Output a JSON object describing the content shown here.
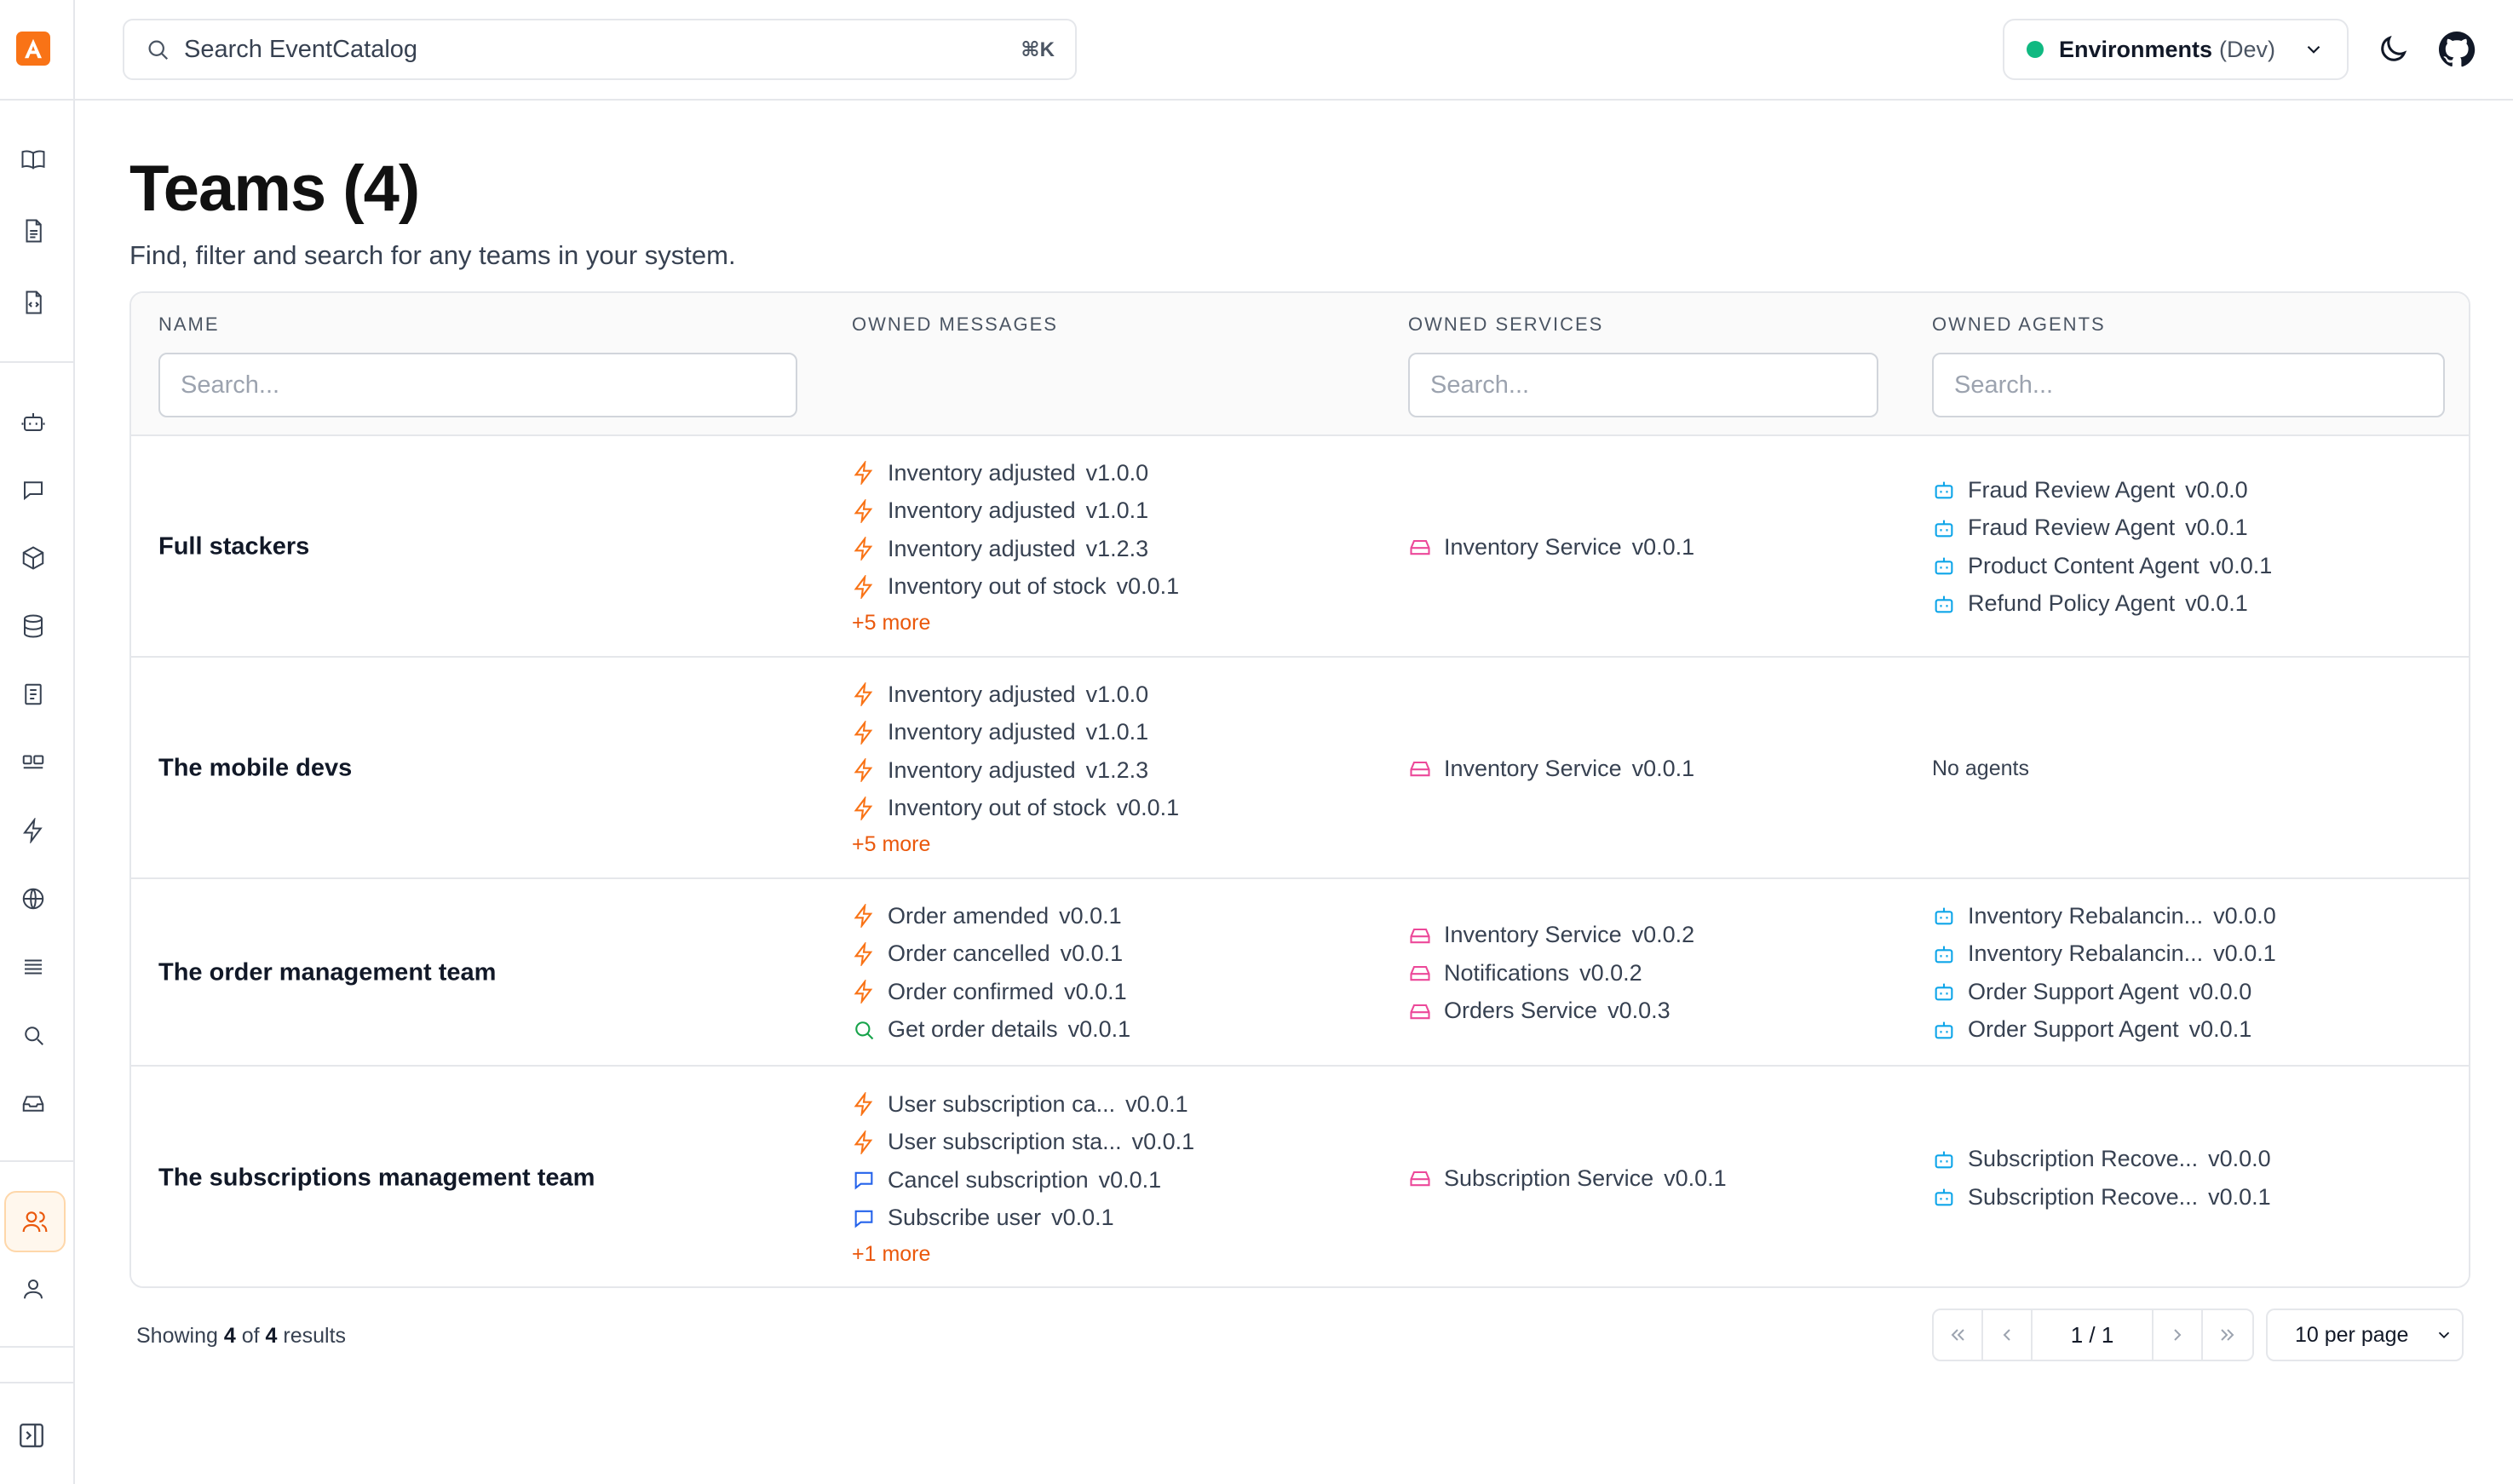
{
  "app": {
    "logo_letter": "A",
    "accent": "#f97316"
  },
  "search": {
    "placeholder": "Search EventCatalog",
    "shortcut": "⌘K"
  },
  "environment": {
    "label": "Environments",
    "value": "(Dev)",
    "status_color": "#10b981"
  },
  "page": {
    "title": "Teams (4)",
    "subtitle": "Find, filter and search for any teams in your system."
  },
  "table": {
    "headers": {
      "name": "NAME",
      "messages": "OWNED MESSAGES",
      "services": "OWNED SERVICES",
      "agents": "OWNED AGENTS"
    },
    "filter_placeholder": "Search...",
    "no_agents": "No agents",
    "rows": [
      {
        "name": "Full stackers",
        "messages": [
          {
            "icon": "event-icon",
            "label": "Inventory adjusted",
            "version": "v1.0.0"
          },
          {
            "icon": "event-icon",
            "label": "Inventory adjusted",
            "version": "v1.0.1"
          },
          {
            "icon": "event-icon",
            "label": "Inventory adjusted",
            "version": "v1.2.3"
          },
          {
            "icon": "event-icon",
            "label": "Inventory out of stock",
            "version": "v0.0.1"
          }
        ],
        "more": "+5 more",
        "services": [
          {
            "label": "Inventory Service",
            "version": "v0.0.1"
          }
        ],
        "agents": [
          {
            "label": "Fraud Review Agent",
            "version": "v0.0.0"
          },
          {
            "label": "Fraud Review Agent",
            "version": "v0.0.1"
          },
          {
            "label": "Product Content Agent",
            "version": "v0.0.1"
          },
          {
            "label": "Refund Policy Agent",
            "version": "v0.0.1"
          }
        ]
      },
      {
        "name": "The mobile devs",
        "messages": [
          {
            "icon": "event-icon",
            "label": "Inventory adjusted",
            "version": "v1.0.0"
          },
          {
            "icon": "event-icon",
            "label": "Inventory adjusted",
            "version": "v1.0.1"
          },
          {
            "icon": "event-icon",
            "label": "Inventory adjusted",
            "version": "v1.2.3"
          },
          {
            "icon": "event-icon",
            "label": "Inventory out of stock",
            "version": "v0.0.1"
          }
        ],
        "more": "+5 more",
        "services": [
          {
            "label": "Inventory Service",
            "version": "v0.0.1"
          }
        ],
        "agents": []
      },
      {
        "name": "The order management team",
        "messages": [
          {
            "icon": "event-icon",
            "label": "Order amended",
            "version": "v0.0.1"
          },
          {
            "icon": "event-icon",
            "label": "Order cancelled",
            "version": "v0.0.1"
          },
          {
            "icon": "event-icon",
            "label": "Order confirmed",
            "version": "v0.0.1"
          },
          {
            "icon": "query-icon",
            "label": "Get order details",
            "version": "v0.0.1"
          }
        ],
        "more": "",
        "services": [
          {
            "label": "Inventory Service",
            "version": "v0.0.2"
          },
          {
            "label": "Notifications",
            "version": "v0.0.2"
          },
          {
            "label": "Orders Service",
            "version": "v0.0.3"
          }
        ],
        "agents": [
          {
            "label": "Inventory Rebalancin...",
            "version": "v0.0.0"
          },
          {
            "label": "Inventory Rebalancin...",
            "version": "v0.0.1"
          },
          {
            "label": "Order Support Agent",
            "version": "v0.0.0"
          },
          {
            "label": "Order Support Agent",
            "version": "v0.0.1"
          }
        ]
      },
      {
        "name": "The subscriptions management team",
        "messages": [
          {
            "icon": "event-icon",
            "label": "User subscription ca...",
            "version": "v0.0.1"
          },
          {
            "icon": "event-icon",
            "label": "User subscription sta...",
            "version": "v0.0.1"
          },
          {
            "icon": "command-icon",
            "label": "Cancel subscription",
            "version": "v0.0.1"
          },
          {
            "icon": "command-icon",
            "label": "Subscribe user",
            "version": "v0.0.1"
          }
        ],
        "more": "+1 more",
        "services": [
          {
            "label": "Subscription Service",
            "version": "v0.0.1"
          }
        ],
        "agents": [
          {
            "label": "Subscription Recove...",
            "version": "v0.0.0"
          },
          {
            "label": "Subscription Recove...",
            "version": "v0.0.1"
          }
        ]
      }
    ]
  },
  "footer": {
    "showing_prefix": "Showing",
    "showing_count": "4",
    "showing_of": "of",
    "showing_total": "4",
    "showing_suffix": "results",
    "page_indicator": "1 / 1",
    "per_page": "10 per page"
  }
}
